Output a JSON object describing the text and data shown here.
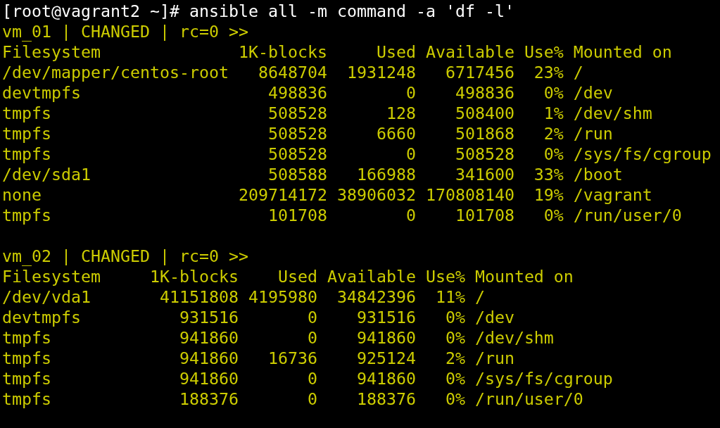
{
  "terminal": {
    "command_line": "[root@vagrant2 ~]# ansible all -m command -a 'df -l'",
    "hosts": [
      {
        "header": "vm_01 | CHANGED | rc=0 >>",
        "changed": true,
        "output": [
          "Filesystem              1K-blocks     Used Available Use% Mounted on",
          "/dev/mapper/centos-root   8648704  1931248   6717456  23% /",
          "devtmpfs                   498836        0    498836   0% /dev",
          "tmpfs                      508528      128    508400   1% /dev/shm",
          "tmpfs                      508528     6660    501868   2% /run",
          "tmpfs                      508528        0    508528   0% /sys/fs/cgroup",
          "/dev/sda1                  508588   166988    341600  33% /boot",
          "none                    209714172 38906032 170808140  19% /vagrant",
          "tmpfs                      101708        0    101708   0% /run/user/0"
        ]
      },
      {
        "header": "vm_02 | CHANGED | rc=0 >>",
        "changed": true,
        "output": [
          "Filesystem     1K-blocks    Used Available Use% Mounted on",
          "/dev/vda1       41151808 4195980  34842396  11% /",
          "devtmpfs          931516       0    931516   0% /dev",
          "tmpfs             941860       0    941860   0% /dev/shm",
          "tmpfs             941860   16736    925124   2% /run",
          "tmpfs             941860       0    941860   0% /sys/fs/cgroup",
          "tmpfs             188376       0    188376   0% /run/user/0"
        ]
      }
    ]
  }
}
